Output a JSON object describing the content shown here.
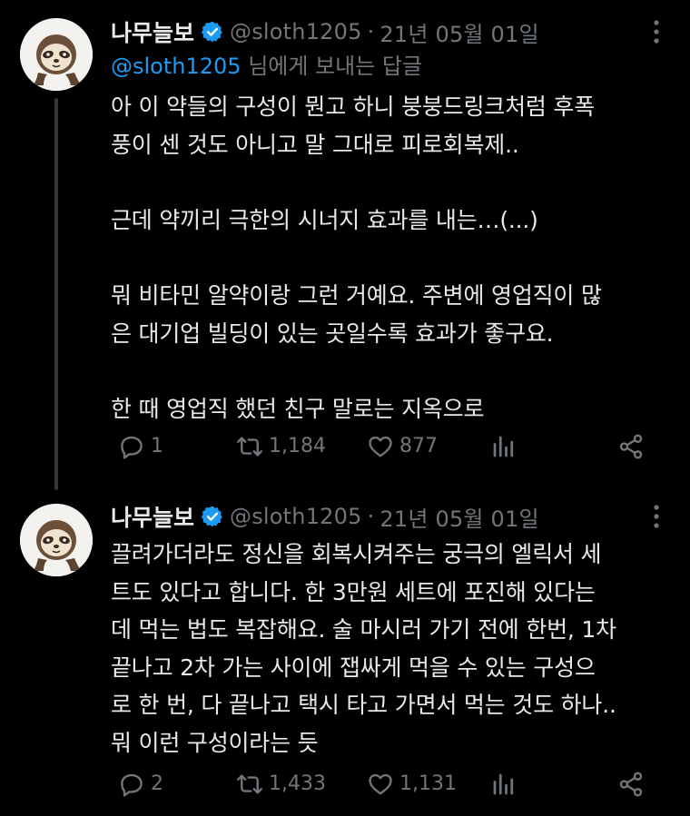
{
  "tweets": [
    {
      "author": {
        "name": "나무늘보",
        "handle": "@sloth1205",
        "date": "21년 05월 01일",
        "separator": "·"
      },
      "reply_to": {
        "mention": "@sloth1205",
        "suffix": " 님에게 보내는 답글"
      },
      "text": "아 이 약들의 구성이 뭔고 하니 붕붕드링크처럼 후폭\n풍이 센 것도 아니고 말 그대로 피로회복제..\n\n근데 약끼리 극한의 시너지 효과를 내는…(...)\n\n뭐 비타민 알약이랑 그런 거예요. 주변에 영업직이 많\n은 대기업 빌딩이 있는 곳일수록 효과가 좋구요.\n\n한 때 영업직 했던 친구 말로는 지옥으로",
      "stats": {
        "replies": "1",
        "retweets": "1,184",
        "likes": "877",
        "views": ""
      }
    },
    {
      "author": {
        "name": "나무늘보",
        "handle": "@sloth1205",
        "date": "21년 05월 01일",
        "separator": "·"
      },
      "text": "끌려가더라도 정신을 회복시켜주는 궁극의 엘릭서 세\n트도 있다고 합니다. 한 3만원 세트에 포진해 있다는\n데 먹는 법도 복잡해요. 술 마시러 가기 전에 한번, 1차\n끝나고 2차 가는 사이에 잽싸게 먹을 수 있는 구성으\n로 한 번, 다 끝나고 택시 타고 가면서 먹는 것도 하나..\n뭐 이런 구성이라는 듯",
      "stats": {
        "replies": "2",
        "retweets": "1,433",
        "likes": "1,131",
        "views": ""
      }
    }
  ],
  "icons": {
    "verified": "verified-badge-icon",
    "more": "more-options-icon",
    "reply": "reply-icon",
    "retweet": "retweet-icon",
    "like": "like-icon",
    "views": "views-icon",
    "share": "share-icon"
  },
  "colors": {
    "background": "#000000",
    "text": "#e7e9ea",
    "muted": "#71767b",
    "accent": "#1d9bf0",
    "thread_line": "#333639"
  }
}
